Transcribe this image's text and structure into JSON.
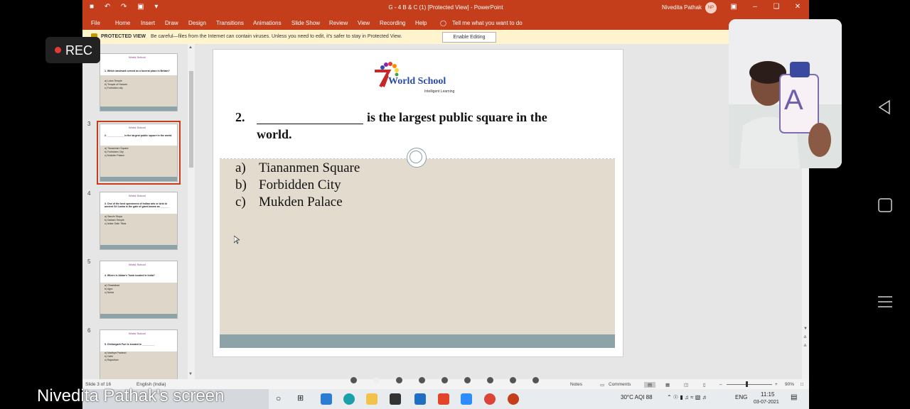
{
  "window": {
    "title": "G - 4 B & C (1) [Protected View]  -  PowerPoint",
    "user_name": "Nivedita Pathak",
    "user_initials": "NP",
    "quick_access": "■ ↶ ↷ ▣ ▾"
  },
  "ribbon": {
    "tabs": [
      "File",
      "Home",
      "Insert",
      "Draw",
      "Design",
      "Transitions",
      "Animations",
      "Slide Show",
      "Review",
      "View",
      "Recording",
      "Help"
    ],
    "tell_me": "Tell me what you want to do"
  },
  "protected_view": {
    "title": "PROTECTED VIEW",
    "message": "Be careful—files from the Internet can contain viruses. Unless you need to edit, it's safer to stay in Protected View.",
    "button": "Enable Editing"
  },
  "thumbnails": [
    {
      "number": "",
      "question": "1.  Which landmark served as a funeral place in Britain?",
      "options": [
        "a)  Lotus Temple",
        "b)  Temple of Heaven",
        "c)  Forbidden city"
      ]
    },
    {
      "number": "3",
      "question": "2.  ____________ is the largest  public square in the world.",
      "options": [
        "a)  Tiananmen Square",
        "b)  Forbidden City",
        "c)  Mukden Palace"
      ]
    },
    {
      "number": "4",
      "question": "3.  One of the best specimens of Indian arts or Arts to ancient Sri Lanka is the gate of giant known as ______",
      "options": [
        "a)  Sanchi Stupa",
        "b)  Kailash Temple",
        "c)  Ishtar Gate Tikas"
      ]
    },
    {
      "number": "5",
      "question": "4.  Where is Akbar's Tomb located in India?",
      "options": [
        "a)  Ghaziabad",
        "b)  Agra",
        "c)  Noida"
      ]
    },
    {
      "number": "6",
      "question": "5.  Chittorgarh Fort is located in _________",
      "options": [
        "a)  Madhya Pradesh",
        "b)  Delhi",
        "c)  Rajasthan"
      ]
    }
  ],
  "slide": {
    "logo_text": "World School",
    "logo_tagline": "Intelligent Learning",
    "question_number": "2.",
    "question_text": "is the largest  public square in the",
    "question_text_cont": "world.",
    "options": [
      {
        "label": "a)",
        "text": "Tiananmen Square"
      },
      {
        "label": "b)",
        "text": "Forbidden City"
      },
      {
        "label": "c)",
        "text": "Mukden Palace"
      }
    ]
  },
  "status": {
    "slide_info": "Slide 3 of 16",
    "language": "English (India)",
    "notes": "Notes",
    "comments": "Comments",
    "zoom": "90%"
  },
  "overlay": {
    "rec_label": "REC",
    "caption": "Nivedita Pathak's screen",
    "webcam_card_letter": "A"
  },
  "taskbar": {
    "weather": "30°C  AQI 88",
    "lang": "ENG",
    "time": "11:15",
    "date": "03-07-2021"
  },
  "colors": {
    "accent": "#c43e1c",
    "protected_bar": "#fff4ce",
    "slide_bg": "#e4dbcf",
    "slide_band": "#8ca3a8"
  }
}
